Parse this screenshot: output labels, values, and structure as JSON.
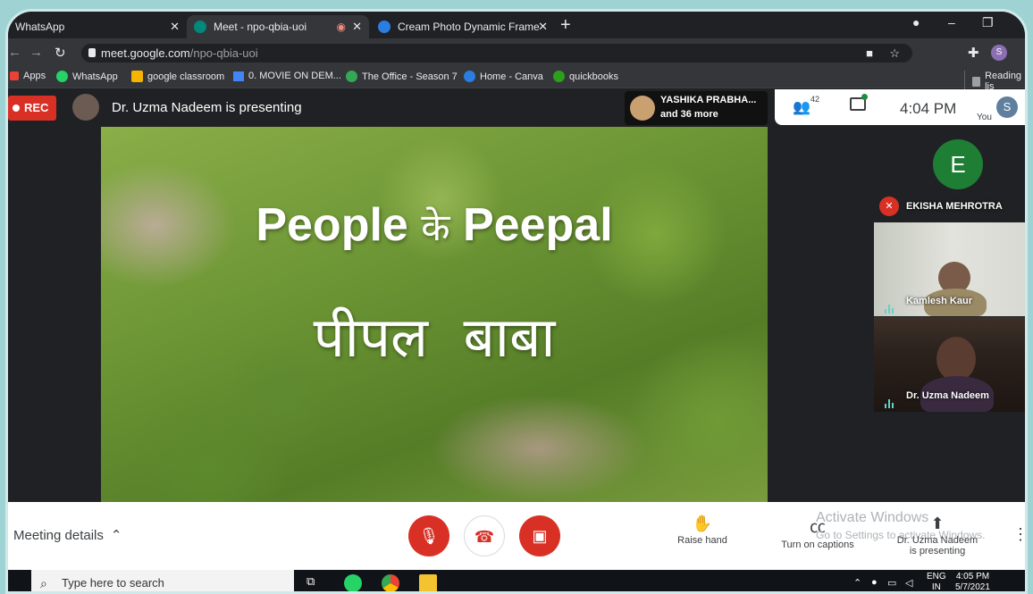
{
  "browser": {
    "tabs": [
      {
        "label": "WhatsApp"
      },
      {
        "label": "Meet - npo-qbia-uoi"
      },
      {
        "label": "Cream Photo Dynamic Frame Ea"
      }
    ],
    "url_host": "meet.google.com",
    "url_path": "/npo-qbia-uoi",
    "profile_initial": "S",
    "bookmarks": [
      "Apps",
      "WhatsApp",
      "google classroom",
      "0. MOVIE ON DEM...",
      "The Office - Season 7",
      "Home - Canva",
      "quickbooks"
    ],
    "reading_list": "Reading lis"
  },
  "meet": {
    "rec_label": "REC",
    "presenting_text": "Dr. Uzma Nadeem is presenting",
    "participants_name": "YASHIKA PRABHA...",
    "participants_more": "and 36 more",
    "people_count": "42",
    "time": "4:04 PM",
    "you_label": "You",
    "self_initial": "S",
    "slide_title_en_1": "People",
    "slide_title_hi_join": "के",
    "slide_title_en_2": "Peepal",
    "slide_subtitle_hi": "पीपल  बाबा",
    "tiles": [
      {
        "initial": "E",
        "name": "EKISHA MEHROTRA"
      },
      {
        "name": "Kamlesh Kaur"
      },
      {
        "name": "Dr. Uzma Nadeem"
      }
    ],
    "meeting_details": "Meeting details",
    "raise_hand": "Raise hand",
    "captions": "Turn on captions",
    "present_name": "Dr. Uzma Nadeem",
    "present_status": "is presenting",
    "watermark_1": "Activate Windows",
    "watermark_2": "Go to Settings to activate Windows."
  },
  "taskbar": {
    "search_placeholder": "Type here to search",
    "lang_1": "ENG",
    "lang_2": "IN",
    "clock_time": "4:05 PM",
    "clock_date": "5/7/2021"
  },
  "colors": {
    "accent_red": "#d93025",
    "meet_dark": "#202124",
    "avatar_green": "#1e7e34"
  }
}
